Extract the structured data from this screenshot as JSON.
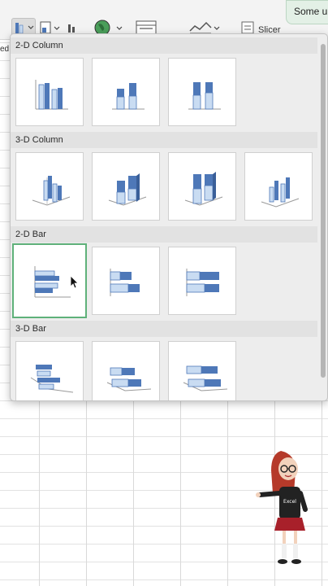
{
  "ribbon": {
    "slicer_label": "Slicer",
    "edge_label": "ed"
  },
  "notification": {
    "text": "Some u"
  },
  "dropdown": {
    "sections": [
      {
        "title": "2-D Column",
        "items": [
          "Clustered Column",
          "Stacked Column",
          "100% Stacked Column"
        ]
      },
      {
        "title": "3-D Column",
        "items": [
          "3-D Clustered Column",
          "3-D Stacked Column",
          "3-D 100% Stacked Column",
          "3-D Column"
        ]
      },
      {
        "title": "2-D Bar",
        "items": [
          "Clustered Bar",
          "Stacked Bar",
          "100% Stacked Bar"
        ],
        "selected_index": 0
      },
      {
        "title": "3-D Bar",
        "items": [
          "3-D Clustered Bar",
          "3-D Stacked Bar",
          "3-D 100% Stacked Bar"
        ]
      }
    ]
  },
  "colors": {
    "series_dark": "#4e78b8",
    "series_light": "#c9dcf2",
    "selected_border": "#5fb17a"
  },
  "character": {
    "shirt_text": "Excel"
  }
}
